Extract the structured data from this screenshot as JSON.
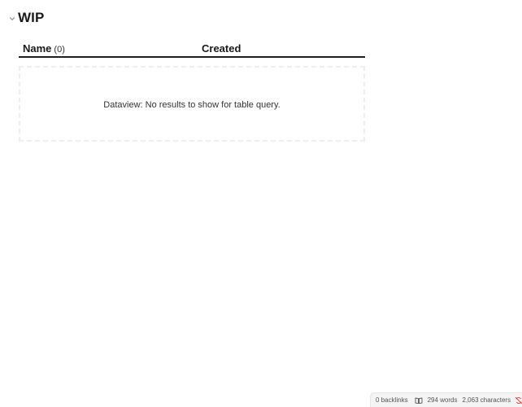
{
  "heading": {
    "title": "WIP",
    "chevron_icon": "chevron-down-icon"
  },
  "table": {
    "columns": [
      {
        "label": "Name",
        "count": "(0)"
      },
      {
        "label": "Created"
      }
    ],
    "empty_message": "Dataview: No results to show for table query."
  },
  "status_bar": {
    "backlinks": "0 backlinks",
    "reading_icon": "book-open-icon",
    "words": "294 words",
    "characters": "2,063 characters",
    "sync_icon": "sync-error-icon",
    "sync_color": "#e03e3e"
  }
}
